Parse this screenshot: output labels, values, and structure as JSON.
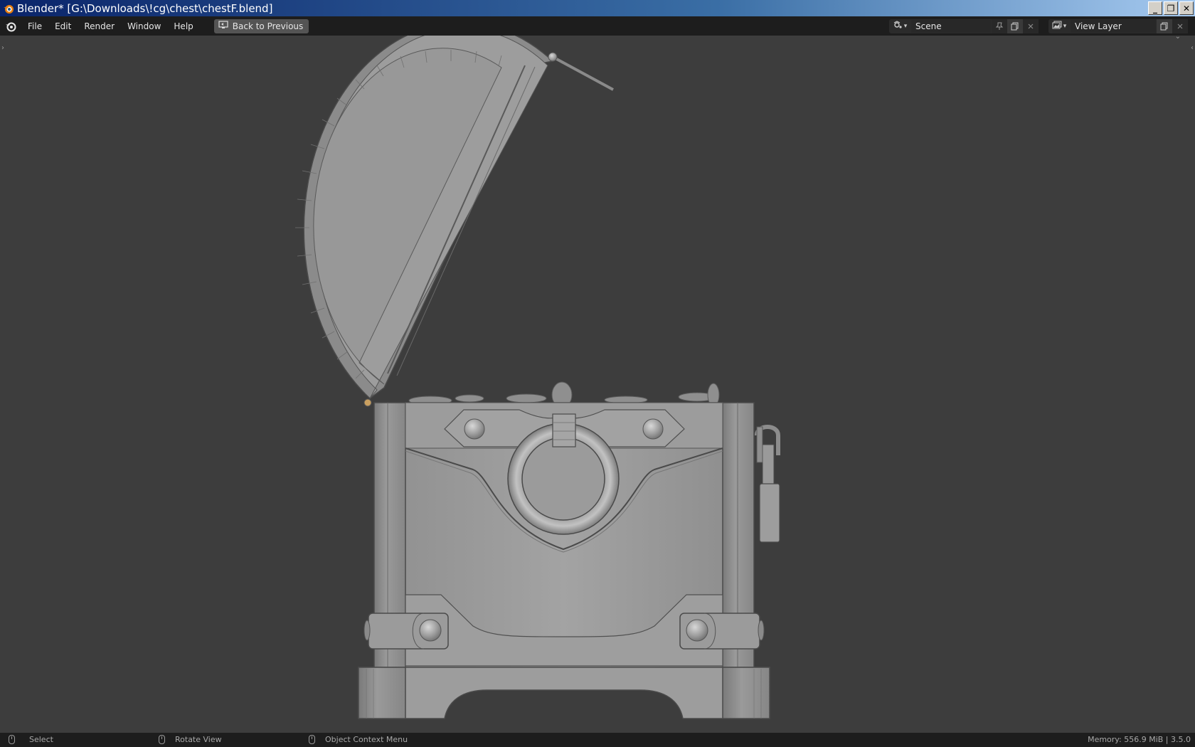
{
  "window": {
    "title": "Blender* [G:\\Downloads\\!cg\\chest\\chestF.blend]",
    "controls": [
      "_",
      "❐",
      "✕"
    ]
  },
  "menubar": {
    "items": [
      "File",
      "Edit",
      "Render",
      "Window",
      "Help"
    ],
    "back_button": "Back to Previous",
    "scene_name": "Scene",
    "view_layer_name": "View Layer"
  },
  "statusbar": {
    "select": "Select",
    "rotate": "Rotate View",
    "context_menu": "Object Context Menu",
    "memory": "Memory: 556.9 MiB | 3.5.0"
  },
  "viewport": {
    "shading": "solid",
    "background_color": "#3d3d3d",
    "object": "treasure chest with open lid"
  }
}
